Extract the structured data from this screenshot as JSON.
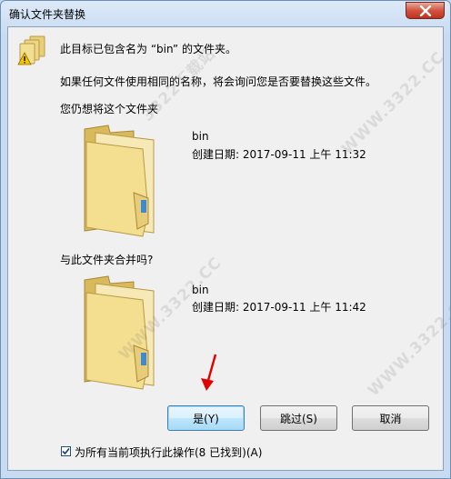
{
  "window": {
    "title": "确认文件夹替换"
  },
  "message": {
    "line1": "此目标已包含名为 “bin” 的文件夹。",
    "line2": "如果任何文件使用相同的名称，将会询问您是否要替换这些文件。",
    "line3": "您仍想将这个文件夹"
  },
  "target_folder": {
    "name": "bin",
    "date": "创建日期: 2017-09-11 上午 11:32"
  },
  "merge_prompt": "与此文件夹合并吗?",
  "source_folder": {
    "name": "bin",
    "date": "创建日期: 2017-09-11 上午 11:42"
  },
  "buttons": {
    "yes": "是(Y)",
    "skip": "跳过(S)",
    "cancel": "取消"
  },
  "apply_all": {
    "label": "为所有当前项执行此操作(8 已找到)(A)",
    "checked": true
  },
  "watermark": "WWW.3322.CC",
  "watermark_logo": "3322下载站"
}
